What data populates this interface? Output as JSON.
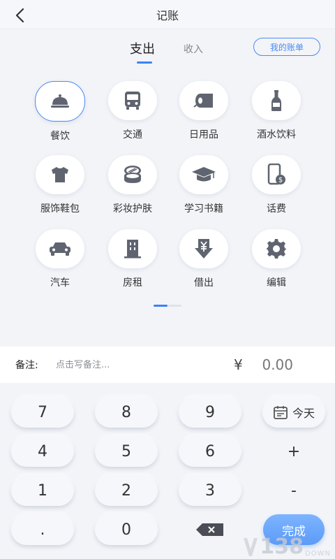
{
  "header": {
    "title": "记账"
  },
  "tabs": {
    "expense": "支出",
    "income": "收入",
    "bill_button": "我的账单"
  },
  "categories": [
    {
      "label": "餐饮",
      "icon": "food-cloche-icon",
      "selected": true
    },
    {
      "label": "交通",
      "icon": "bus-icon"
    },
    {
      "label": "日用品",
      "icon": "tissue-roll-icon"
    },
    {
      "label": "酒水饮料",
      "icon": "bottle-icon"
    },
    {
      "label": "服饰鞋包",
      "icon": "tshirt-icon"
    },
    {
      "label": "彩妆护肤",
      "icon": "cosmetics-compact-icon"
    },
    {
      "label": "学习书籍",
      "icon": "graduation-cap-icon"
    },
    {
      "label": "话费",
      "icon": "phone-bill-icon"
    },
    {
      "label": "汽车",
      "icon": "car-icon"
    },
    {
      "label": "房租",
      "icon": "building-icon"
    },
    {
      "label": "借出",
      "icon": "lend-yen-icon"
    },
    {
      "label": "编辑",
      "icon": "gear-icon"
    }
  ],
  "note": {
    "label": "备注:",
    "placeholder": "点击写备注...",
    "currency": "¥",
    "amount": "0.00"
  },
  "keypad": {
    "k7": "7",
    "k8": "8",
    "k9": "9",
    "today": "今天",
    "k4": "4",
    "k5": "5",
    "k6": "6",
    "plus": "+",
    "k1": "1",
    "k2": "2",
    "k3": "3",
    "minus": "-",
    "dot": ".",
    "k0": "0",
    "done": "完成"
  },
  "watermark": {
    "number": "138",
    "text": "DOWN"
  },
  "colors": {
    "accent": "#4a8af4",
    "icon": "#5f6470",
    "background": "#f3f4f8"
  }
}
